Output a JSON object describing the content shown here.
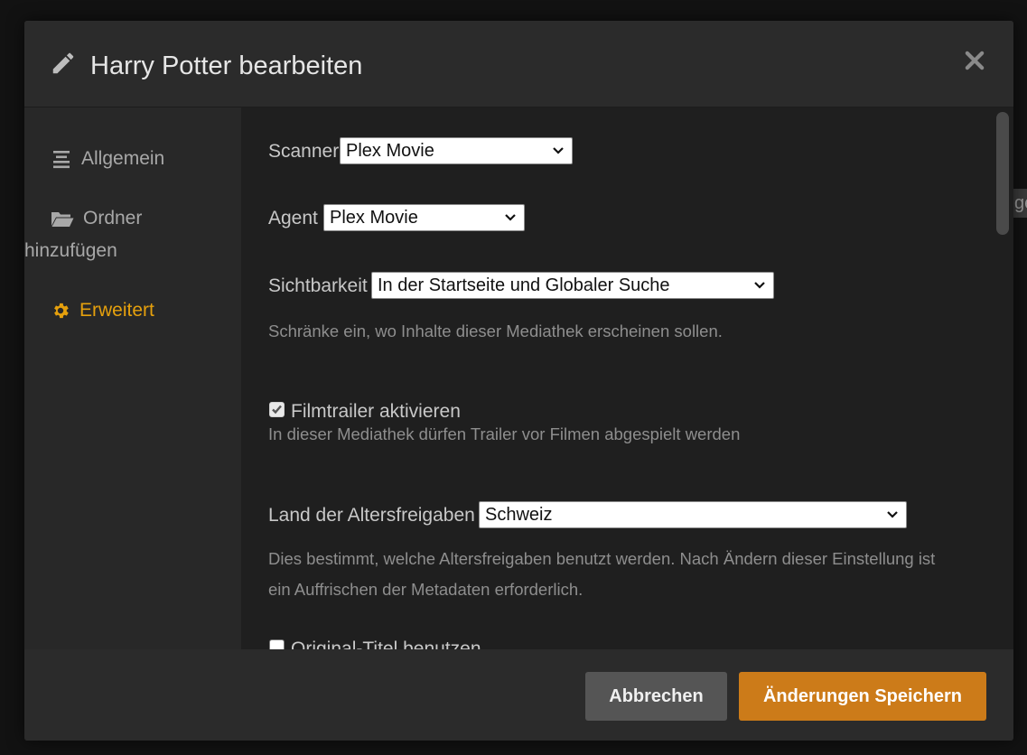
{
  "background": {
    "peek_text": "ge"
  },
  "modal": {
    "title": "Harry Potter bearbeiten",
    "icons": {
      "title_icon": "pencil-icon",
      "close_icon": "close-icon"
    }
  },
  "sidebar": {
    "items": [
      {
        "label": "Allgemein",
        "icon": "list-icon",
        "active": false
      },
      {
        "label": "Ordner",
        "label_line2": "hinzufügen",
        "icon": "folder-icon",
        "active": false
      },
      {
        "label": "Erweitert",
        "icon": "gear-icon",
        "active": true
      }
    ]
  },
  "settings": {
    "scanner": {
      "label": "Scanner",
      "value": "Plex Movie"
    },
    "agent": {
      "label": "Agent",
      "value": "Plex Movie"
    },
    "visibility": {
      "label": "Sichtbarkeit",
      "value": "In der Startseite und Globaler Suche",
      "help": "Schränke ein, wo Inhalte dieser Mediathek erscheinen sollen."
    },
    "trailers": {
      "label": "Filmtrailer aktivieren",
      "checked": true,
      "help": "In dieser Mediathek dürfen Trailer vor Filmen abgespielt werden"
    },
    "rating_country": {
      "label": "Land der Altersfreigaben",
      "value": "Schweiz",
      "help_line1": "Dies bestimmt, welche Altersfreigaben benutzt werden. Nach Ändern dieser Einstellung ist",
      "help_line2": "ein Auffrischen der Metadaten erforderlich."
    },
    "original_title": {
      "label": "Original-Titel benutzen",
      "checked": false
    }
  },
  "footer": {
    "cancel_label": "Abbrechen",
    "save_label": "Änderungen Speichern"
  },
  "colors": {
    "accent": "#e5a00d",
    "save_button": "#cc7b19",
    "cancel_button": "#555555"
  }
}
